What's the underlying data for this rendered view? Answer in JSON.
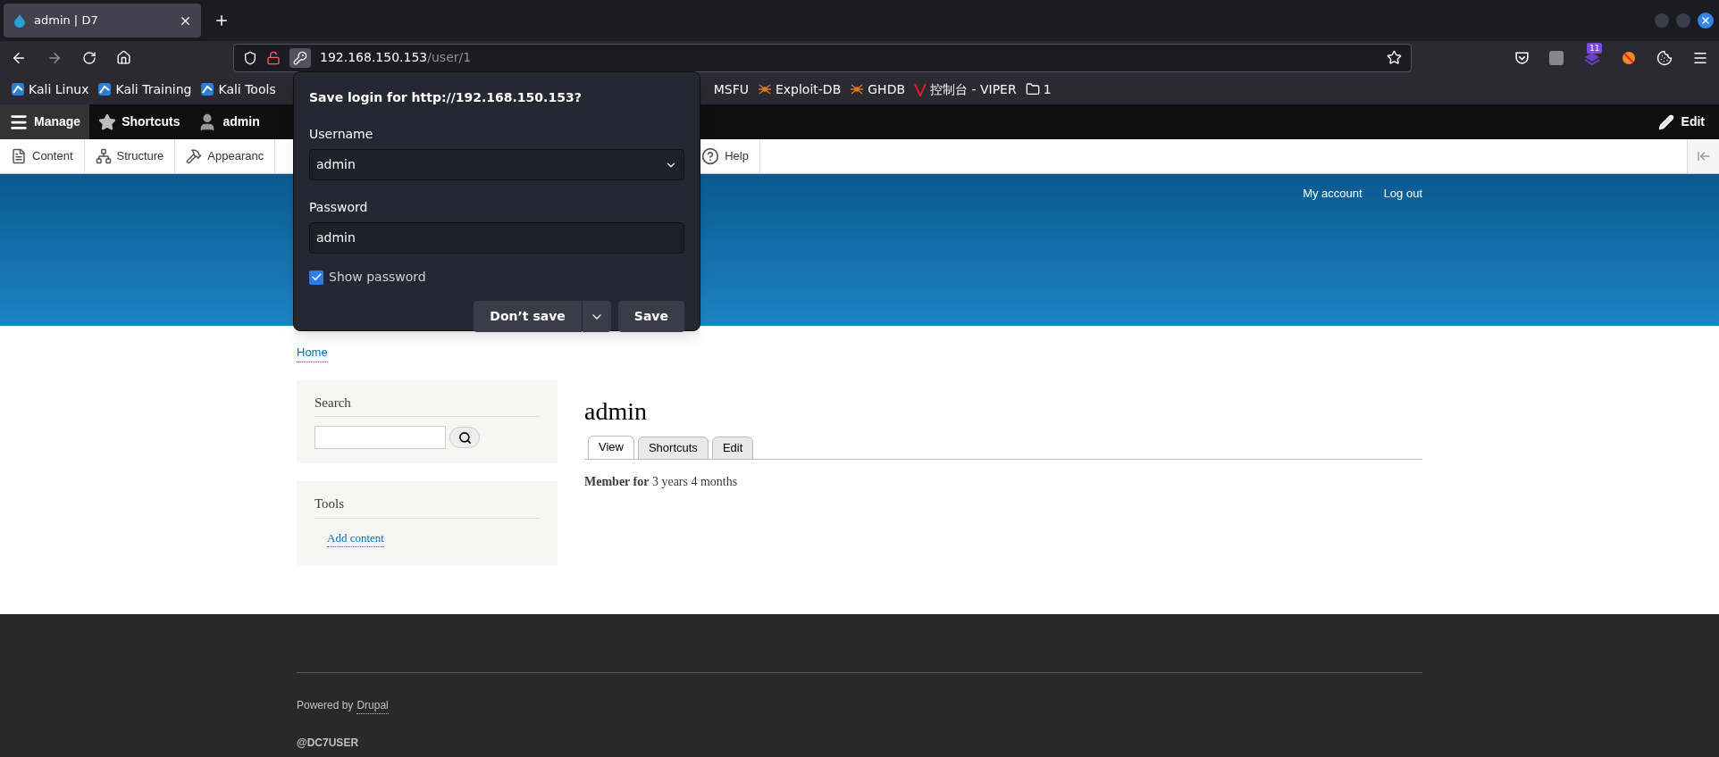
{
  "browser": {
    "tab": {
      "title": "admin | D7"
    },
    "url": {
      "host": "192.168.150.153",
      "path": "/user/1"
    },
    "extension_badge": "11",
    "bookmarks": [
      {
        "label": "Kali Linux",
        "kind": "kali"
      },
      {
        "label": "Kali Training",
        "kind": "kali"
      },
      {
        "label": "Kali Tools",
        "kind": "kali"
      }
    ],
    "bookmarks_right": [
      {
        "label": "MSFU",
        "kind": "plain"
      },
      {
        "label": "Exploit-DB",
        "kind": "spider"
      },
      {
        "label": "GHDB",
        "kind": "spider"
      },
      {
        "label": "控制台 - VIPER",
        "kind": "viper"
      },
      {
        "label": "1",
        "kind": "folder"
      }
    ]
  },
  "admin_toolbar": {
    "items": [
      {
        "label": "Manage",
        "kind": "menu",
        "selected": true
      },
      {
        "label": "Shortcuts",
        "kind": "star",
        "selected": false
      },
      {
        "label": "admin",
        "kind": "user",
        "selected": false
      }
    ],
    "edit": "Edit",
    "tray": [
      {
        "label": "Content",
        "kind": "file"
      },
      {
        "label": "Structure",
        "kind": "tree"
      },
      {
        "label": "Appearanc",
        "kind": "hammer"
      }
    ],
    "tray_right": [
      {
        "label": "Help",
        "kind": "help"
      }
    ]
  },
  "header_links": [
    "My account",
    "Log out"
  ],
  "breadcrumb": "Home",
  "sidebar": {
    "search": {
      "title": "Search"
    },
    "tools": {
      "title": "Tools",
      "links": [
        "Add content"
      ]
    }
  },
  "page": {
    "title": "admin",
    "tabs": [
      {
        "label": "View",
        "selected": true
      },
      {
        "label": "Shortcuts",
        "selected": false
      },
      {
        "label": "Edit",
        "selected": false
      }
    ],
    "member_label": "Member for",
    "member_value": "3 years 4 months"
  },
  "footer": {
    "powered_by": "Powered by",
    "link": "Drupal",
    "tagline": "@DC7USER"
  },
  "dialog": {
    "title": "Save login for http://192.168.150.153?",
    "username_label": "Username",
    "username_value": "admin",
    "password_label": "Password",
    "password_value": "admin",
    "show_password": {
      "label": "Show password",
      "checked": true
    },
    "dont_save": "Don’t save",
    "save": "Save"
  }
}
